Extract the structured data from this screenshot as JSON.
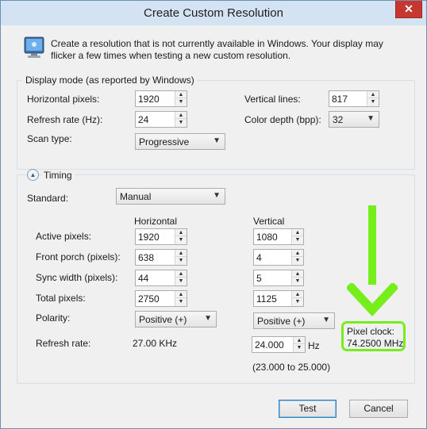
{
  "window": {
    "title": "Create Custom Resolution",
    "close_glyph": "✕"
  },
  "intro": {
    "icon": "monitor-icon",
    "text": "Create a resolution that is not currently available in Windows. Your display may flicker a few times when testing a new custom resolution."
  },
  "display_mode": {
    "label": "Display mode (as reported by Windows)",
    "horizontal_pixels_label": "Horizontal pixels:",
    "horizontal_pixels": "1920",
    "refresh_rate_label": "Refresh rate (Hz):",
    "refresh_rate": "24",
    "scan_type_label": "Scan type:",
    "scan_type": "Progressive",
    "vertical_lines_label": "Vertical lines:",
    "vertical_lines": "817",
    "color_depth_label": "Color depth (bpp):",
    "color_depth": "32"
  },
  "timing": {
    "label": "Timing",
    "standard_label": "Standard:",
    "standard": "Manual",
    "col_horizontal": "Horizontal",
    "col_vertical": "Vertical",
    "rows": {
      "active_pixels": {
        "label": "Active pixels:",
        "h": "1920",
        "v": "1080"
      },
      "front_porch": {
        "label": "Front porch (pixels):",
        "h": "638",
        "v": "4"
      },
      "sync_width": {
        "label": "Sync width (pixels):",
        "h": "44",
        "v": "5"
      },
      "total_pixels": {
        "label": "Total pixels:",
        "h": "2750",
        "v": "1125"
      },
      "polarity": {
        "label": "Polarity:",
        "h": "Positive (+)",
        "v": "Positive (+)"
      },
      "refresh_rate": {
        "label": "Refresh rate:",
        "h": "27.00 KHz",
        "v": "24.000",
        "unit": "Hz"
      }
    },
    "refresh_range": "(23.000 to 25.000)",
    "pixel_clock_label": "Pixel clock:",
    "pixel_clock": "74.2500 MHz"
  },
  "buttons": {
    "test": "Test",
    "cancel": "Cancel"
  },
  "colors": {
    "annotation": "#76ee1c",
    "titlebar": "#d4e3f3",
    "close": "#c7372f"
  }
}
